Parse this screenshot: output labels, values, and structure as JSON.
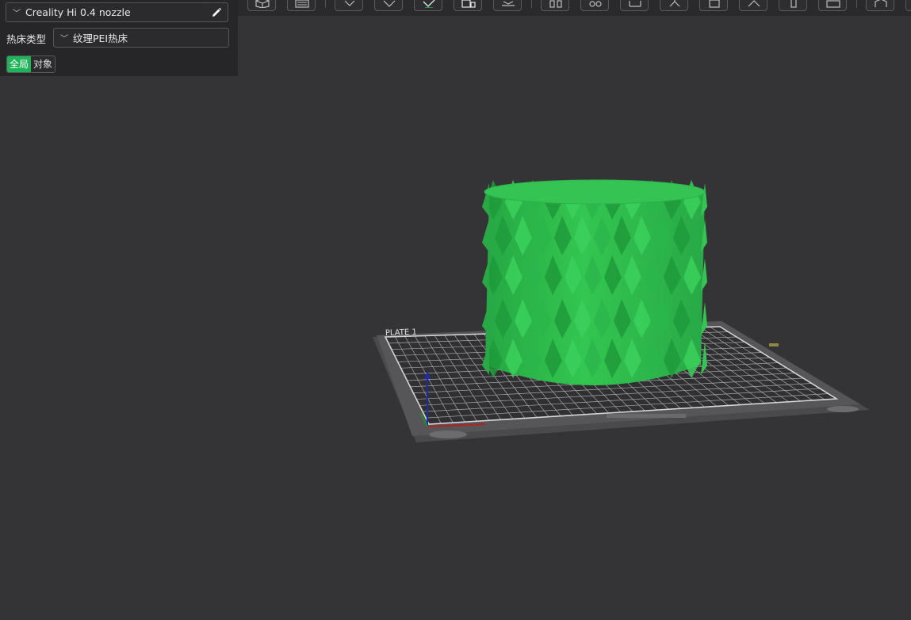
{
  "printer": {
    "name": "Creality Hi 0.4 nozzle"
  },
  "bed": {
    "label": "热床类型",
    "value": "纹理PEI热床"
  },
  "scope_tabs": [
    {
      "label": "全局",
      "active": true
    },
    {
      "label": "对象",
      "active": false
    }
  ],
  "toolbar": {
    "icons": [
      "cube-view-icon",
      "keyboard-icon",
      "add-object-icon",
      "orient-icon",
      "auto-arrange-icon",
      "layout-icon",
      "place-on-face-icon",
      "split-objects-icon",
      "split-parts-icon",
      "measure-icon",
      "cut-icon",
      "support-paint-icon",
      "seam-paint-icon",
      "color-paint-icon",
      "text-icon",
      "variable-layer-icon",
      "assembly-icon",
      "more-icon"
    ]
  },
  "scene": {
    "model_color": "#2fbf4f",
    "plate_label": "PLATE 1"
  },
  "colors": {
    "accent": "#21b35a",
    "panel_bg": "#262628",
    "viewport_bg": "#343436"
  }
}
